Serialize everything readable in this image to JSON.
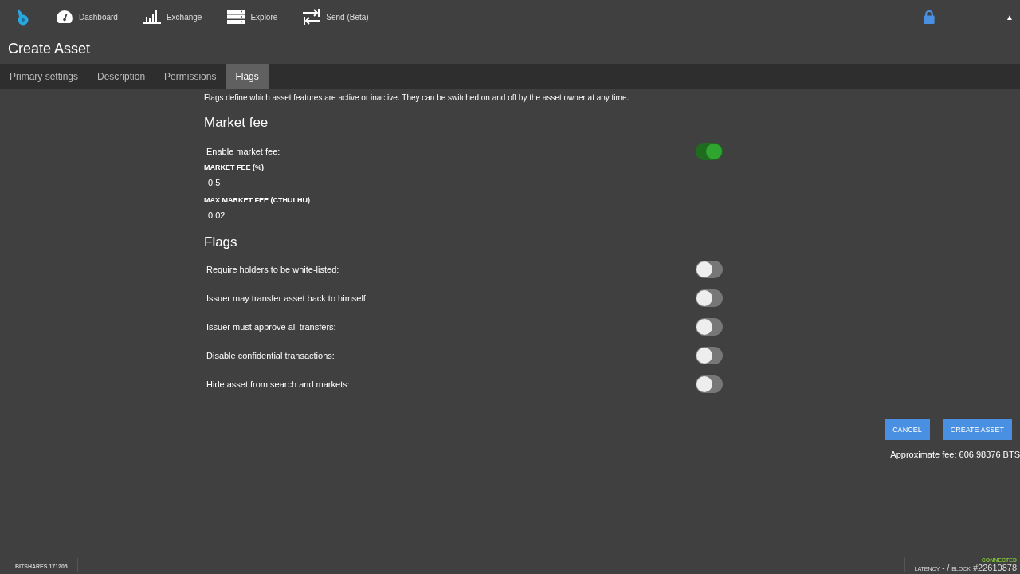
{
  "nav": [
    {
      "kind": "dashboard",
      "label": "Dashboard"
    },
    {
      "kind": "exchange",
      "label": "Exchange"
    },
    {
      "kind": "explore",
      "label": "Explore"
    },
    {
      "kind": "send",
      "label": "Send (Beta)"
    }
  ],
  "header_right": {
    "account_menu_caret": "▲"
  },
  "page_title": "Create Asset",
  "tabs": [
    {
      "label": "Primary settings",
      "selected": false
    },
    {
      "label": "Description",
      "selected": false
    },
    {
      "label": "Permissions",
      "selected": false
    },
    {
      "label": "Flags",
      "selected": true
    }
  ],
  "intro": "Flags define which asset features are active or inactive. They can be switched on and off by the asset owner at any time.",
  "market_fee": {
    "heading": "Market fee",
    "enable_label": "Enable market fee:",
    "enabled": true,
    "fields": [
      {
        "label": "MARKET FEE (%)",
        "value": "0.5"
      },
      {
        "label": "MAX MARKET FEE (CTHULHU)",
        "value": "0.02"
      }
    ]
  },
  "flags": {
    "heading": "Flags",
    "items": [
      {
        "label": "Require holders to be white-listed:",
        "on": false
      },
      {
        "label": "Issuer may transfer asset back to himself:",
        "on": false
      },
      {
        "label": "Issuer must approve all transfers:",
        "on": false
      },
      {
        "label": "Disable confidential transactions:",
        "on": false
      },
      {
        "label": "Hide asset from search and markets:",
        "on": false
      }
    ]
  },
  "actions": {
    "cancel": "CANCEL",
    "create": "CREATE ASSET",
    "fee": "Approximate fee: 606.98376 BTS"
  },
  "footer": {
    "version": "BITSHARES.171205",
    "status": "CONNECTED",
    "latency_label": "LATENCY",
    "latency_value": "- /",
    "block_label": "BLOCK",
    "block_number": "#22610878"
  }
}
